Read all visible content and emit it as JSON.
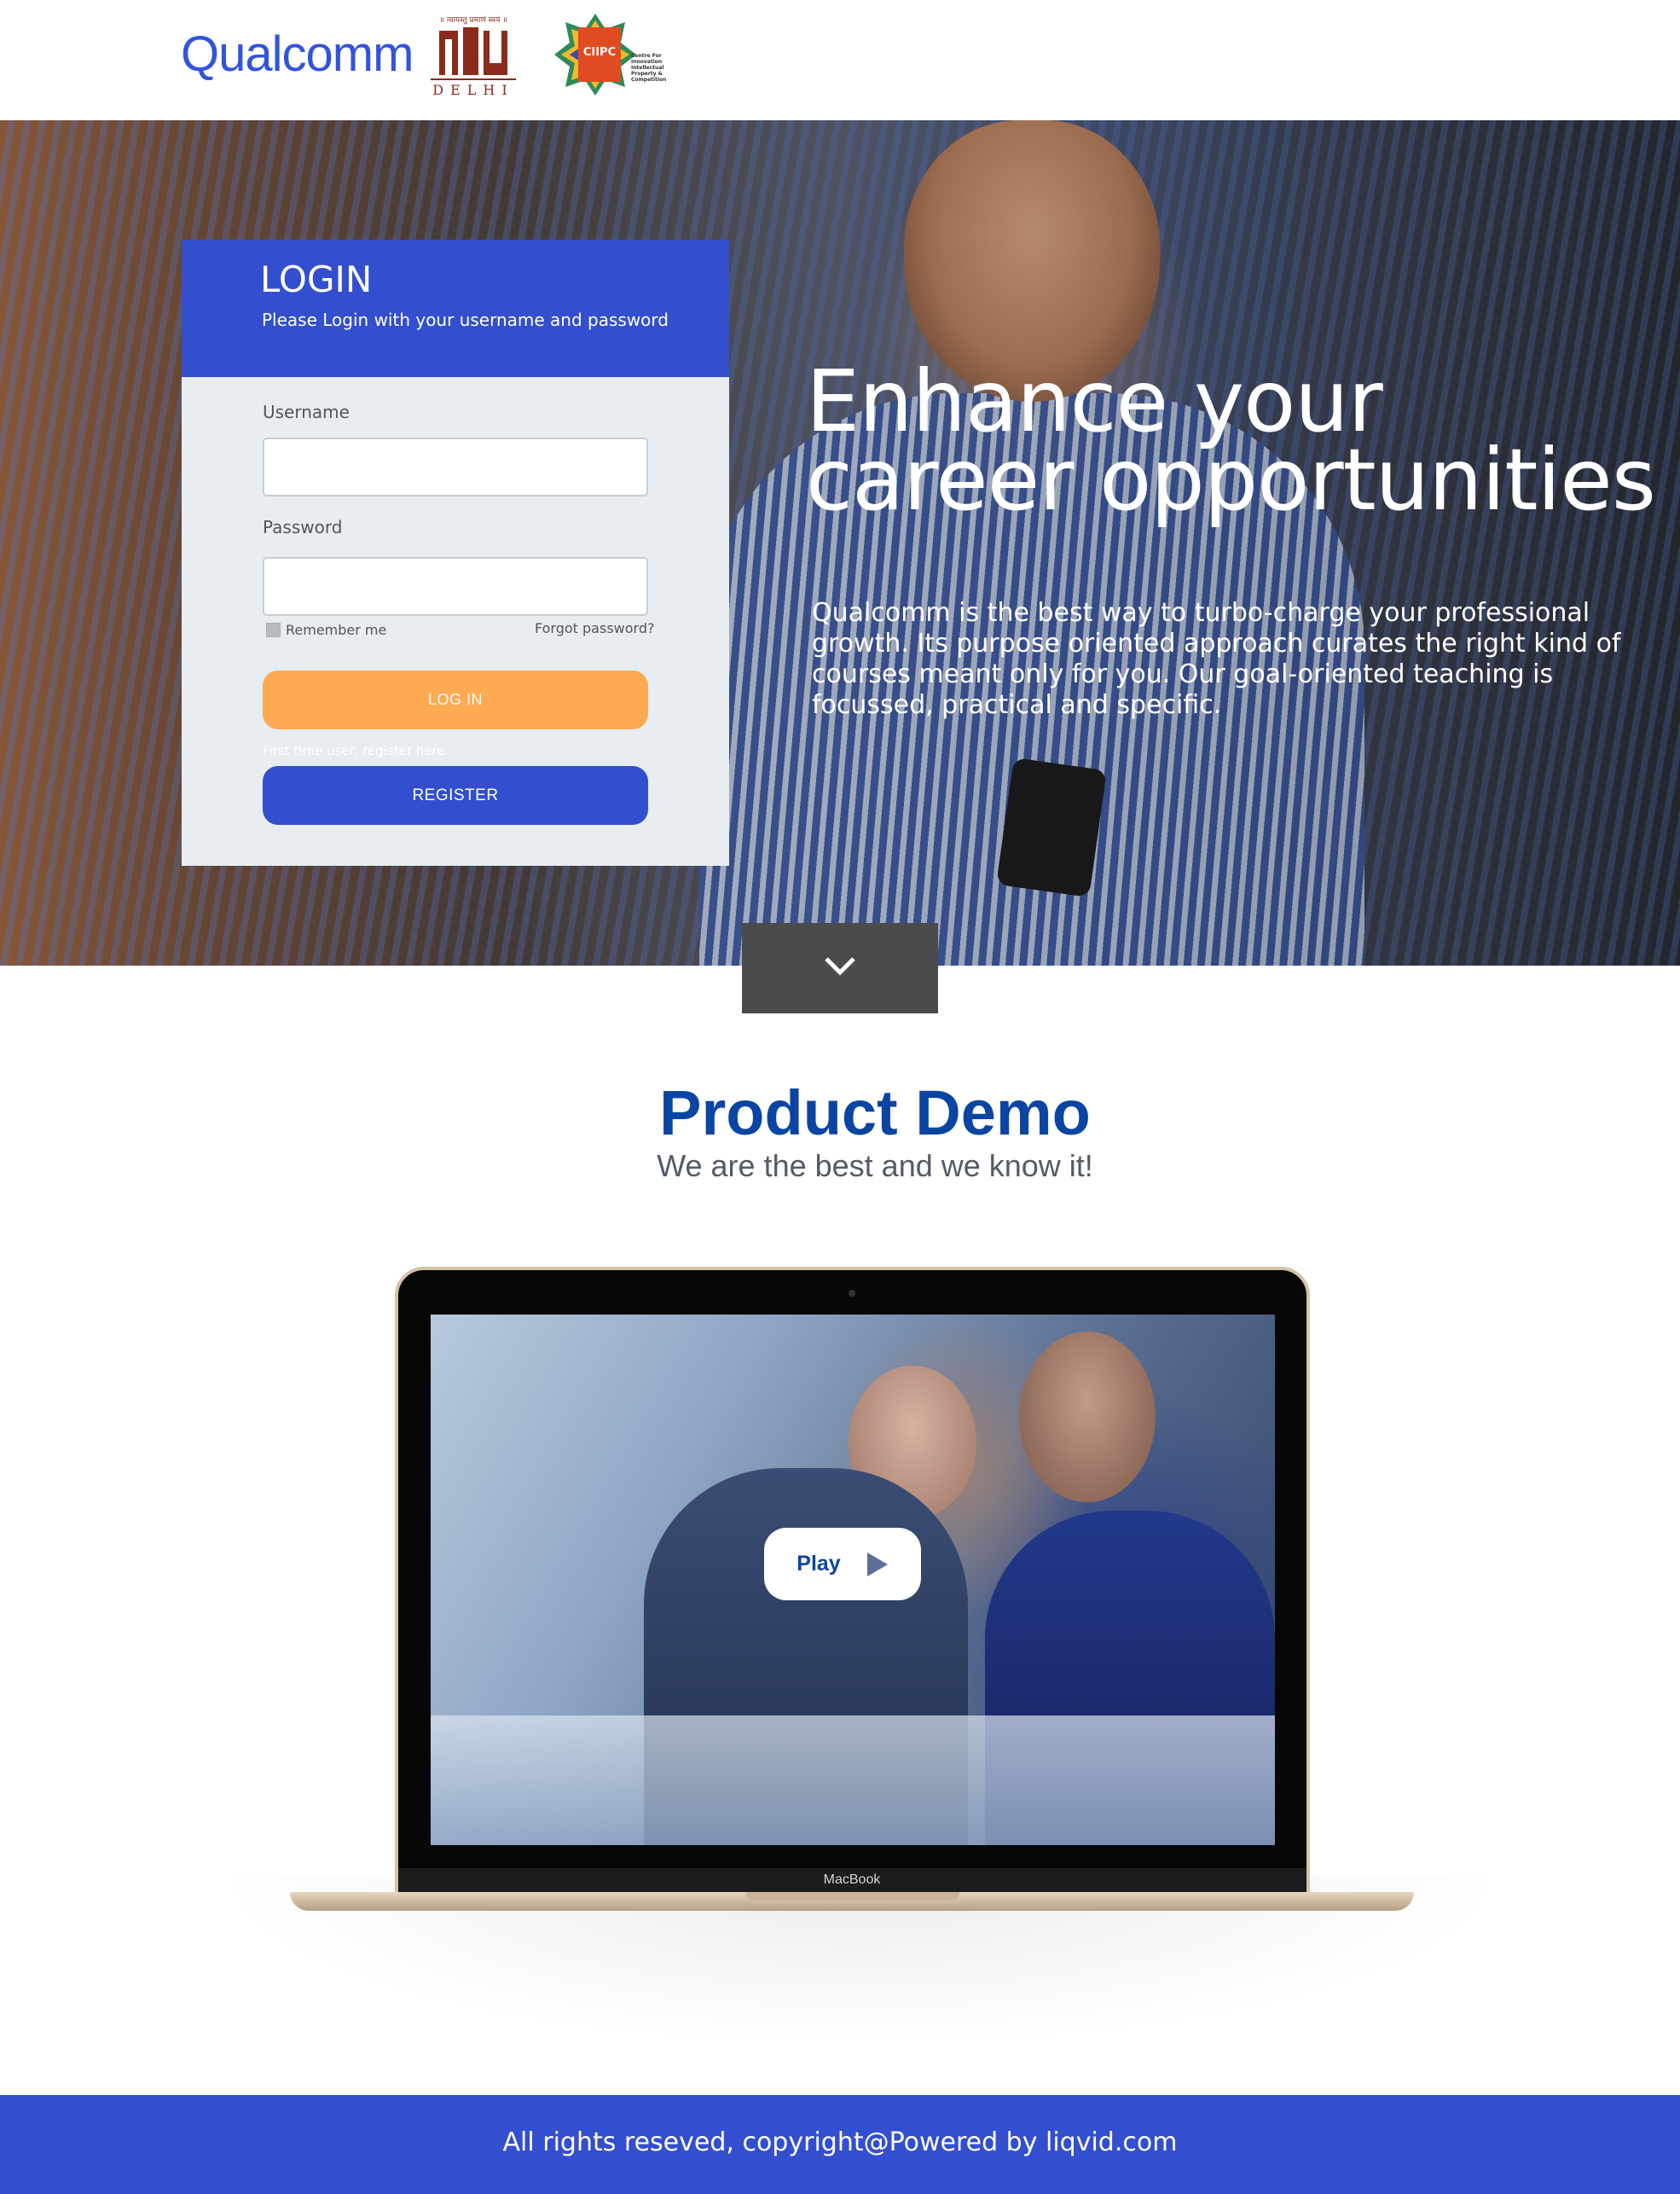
{
  "header": {
    "logos": {
      "qualcomm": "Qualcomm",
      "nlu_tagline": "॥ न्यायस्तु प्रमाणं स्वयं ॥",
      "nlu_mark": "nlu",
      "nlu_city": "DELHI",
      "ciipc": "CIIPC",
      "ciipc_full": "Centre For Innovation Intellectual Property & Competition"
    }
  },
  "login": {
    "title": "LOGIN",
    "subtitle": "Please Login with your username and password",
    "username_label": "Username",
    "username_value": "",
    "password_label": "Password",
    "password_value": "",
    "remember_label": "Remember me",
    "forgot_label": "Forgot password?",
    "login_button": "LOG IN",
    "first_time_text": "First time user, register here",
    "register_button": "REGISTER"
  },
  "hero": {
    "title": "Enhance your career opportunities",
    "description": "Qualcomm is the best way to turbo-charge your professional growth. Its purpose oriented approach curates the right kind of courses meant only for you. Our goal-oriented teaching is focussed, practical and specific."
  },
  "scroll": {
    "icon": "chevron-down-icon"
  },
  "demo": {
    "title": "Product Demo",
    "subtitle": "We are the best and we know it!",
    "play_label": "Play",
    "laptop_brand": "MacBook"
  },
  "footer": {
    "text": "All rights reseved, copyright@Powered by liqvid.com"
  },
  "colors": {
    "brand_blue": "#334FD0",
    "heading_blue": "#0B45A3",
    "login_orange": "#FDAA52"
  }
}
